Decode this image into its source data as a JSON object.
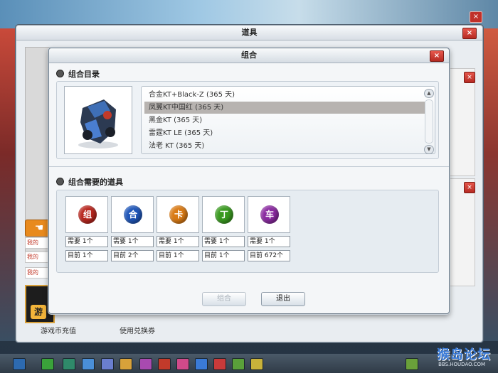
{
  "background": {
    "close_label": "×"
  },
  "outer_window": {
    "title": "道具",
    "close_label": "×",
    "links": [
      "我的",
      "我的",
      "我的"
    ],
    "banner_badge": "游",
    "bottom_texts": [
      "游戏币充值",
      "使用兑换券"
    ],
    "right_close_label": "×"
  },
  "dialog": {
    "title": "组合",
    "close_label": "×",
    "section1_title": "组合目录",
    "section2_title": "组合需要的道具",
    "list_items": [
      {
        "label": "合金KT+Black-Z (365 天)",
        "selected": false
      },
      {
        "label": "凤翼KT中国红 (365 天)",
        "selected": true
      },
      {
        "label": "黑金KT (365 天)",
        "selected": false
      },
      {
        "label": "雷霆KT LE (365 天)",
        "selected": false
      },
      {
        "label": "法老 KT (365 天)",
        "selected": false
      }
    ],
    "scroll_up": "▲",
    "scroll_down": "▼",
    "items": [
      {
        "glyph": "组",
        "color": "#b8261e",
        "need": "需要 1个",
        "current": "目前 1个"
      },
      {
        "glyph": "合",
        "color": "#1f56b8",
        "need": "需要 1个",
        "current": "目前 2个"
      },
      {
        "glyph": "卡",
        "color": "#d97a14",
        "need": "需要 1个",
        "current": "目前 1个"
      },
      {
        "glyph": "丁",
        "color": "#3a9a20",
        "need": "需要 1个",
        "current": "目前 1个"
      },
      {
        "glyph": "车",
        "color": "#8a2aa0",
        "need": "需要 1个",
        "current": "目前 672个"
      }
    ],
    "btn_combine": "组合",
    "btn_exit": "退出"
  },
  "watermark": {
    "text": "猴岛论坛",
    "url": "BBS.HOUDAO.COM"
  }
}
